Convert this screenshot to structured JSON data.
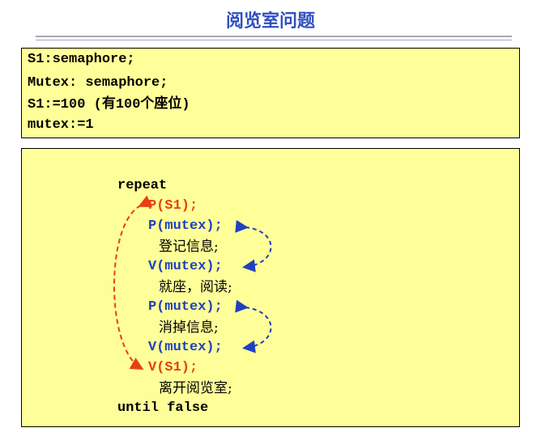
{
  "title": "阅览室问题",
  "declarations": {
    "line1": "S1:semaphore;",
    "line2": "Mutex: semaphore;",
    "line3": "S1:=100 (有100个座位)",
    "line4": "mutex:=1"
  },
  "code": {
    "repeat": "repeat",
    "p_s1": "P(S1);",
    "p_mutex_1": "P(mutex);",
    "register": "登记信息;",
    "v_mutex_1": "V(mutex);",
    "sit_read": "就座，阅读;",
    "p_mutex_2": "P(mutex);",
    "remove_info": "消掉信息;",
    "v_mutex_2": "V(mutex);",
    "v_s1": "V(S1);",
    "leave": "离开阅览室;",
    "until": "until false"
  },
  "colors": {
    "title": "#3050c0",
    "box_fill": "#ffff99",
    "s1_ops": "#e84010",
    "mutex_ops": "#2040c0"
  }
}
